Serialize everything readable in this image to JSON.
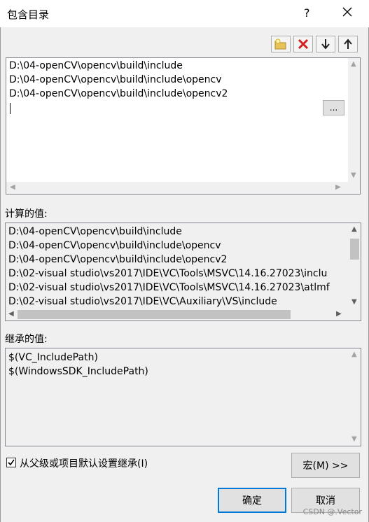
{
  "window": {
    "title": "包含目录",
    "help_label": "?"
  },
  "toolbar": {
    "new_line_icon": "folder-new-icon",
    "delete_icon": "delete-x-icon",
    "move_down_icon": "arrow-down-icon",
    "move_up_icon": "arrow-up-icon"
  },
  "edit_list": {
    "items": [
      "D:\\04-openCV\\opencv\\build\\include",
      "D:\\04-openCV\\opencv\\build\\include\\opencv",
      "D:\\04-openCV\\opencv\\build\\include\\opencv2"
    ],
    "new_item_value": "",
    "browse_label": "..."
  },
  "computed": {
    "label": "计算的值:",
    "items": [
      "D:\\04-openCV\\opencv\\build\\include",
      "D:\\04-openCV\\opencv\\build\\include\\opencv",
      "D:\\04-openCV\\opencv\\build\\include\\opencv2",
      "D:\\02-visual studio\\vs2017\\IDE\\VC\\Tools\\MSVC\\14.16.27023\\inclu",
      "D:\\02-visual studio\\vs2017\\IDE\\VC\\Tools\\MSVC\\14.16.27023\\atlmf",
      "D:\\02-visual studio\\vs2017\\IDE\\VC\\Auxiliary\\VS\\include"
    ]
  },
  "inherited": {
    "label": "继承的值:",
    "items": [
      "$(VC_IncludePath)",
      "$(WindowsSDK_IncludePath)"
    ]
  },
  "inherit_checkbox": {
    "label": "从父级或项目默认设置继承(I)",
    "checked": true
  },
  "buttons": {
    "macros_label": "宏(M) >>",
    "ok_label": "确定",
    "cancel_label": "取消"
  },
  "watermark": "CSDN @.Vector"
}
